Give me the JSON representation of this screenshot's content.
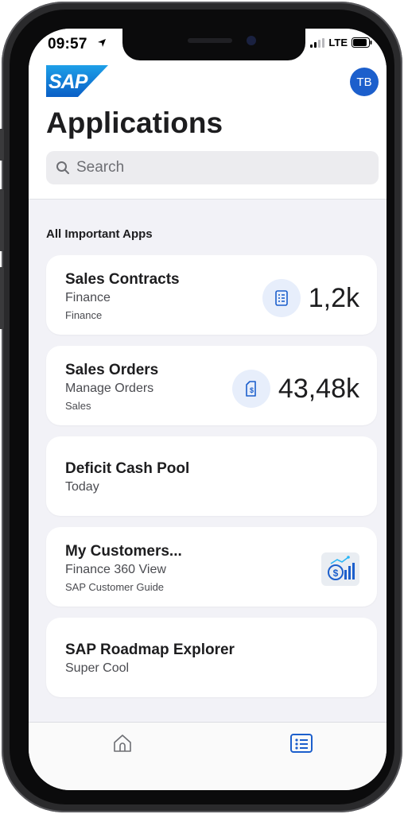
{
  "status": {
    "time": "09:57",
    "network": "LTE"
  },
  "header": {
    "logo_text": "SAP",
    "avatar_initials": "TB",
    "title": "Applications"
  },
  "search": {
    "placeholder": "Search"
  },
  "section": {
    "title": "All Important Apps"
  },
  "cards": [
    {
      "title": "Sales Contracts",
      "subtitle": "Finance",
      "caption": "Finance",
      "kpi": "1,2k",
      "icon": "checklist-icon"
    },
    {
      "title": "Sales Orders",
      "subtitle": "Manage Orders",
      "caption": "Sales",
      "kpi": "43,48k",
      "icon": "dollar-document-icon"
    },
    {
      "title": "Deficit Cash Pool",
      "subtitle": "Today"
    },
    {
      "title": "My Customers...",
      "subtitle": "Finance 360 View",
      "caption": "SAP Customer Guide",
      "icon": "dollar-chart-icon"
    },
    {
      "title": "SAP Roadmap Explorer",
      "subtitle": "Super Cool"
    }
  ],
  "tabs": [
    {
      "name": "home",
      "icon": "home-icon",
      "active": false
    },
    {
      "name": "apps",
      "icon": "list-icon",
      "active": true
    }
  ],
  "colors": {
    "accent": "#1c5fcc",
    "sap_blue": "#0a6ed1",
    "background": "#f2f2f7"
  }
}
